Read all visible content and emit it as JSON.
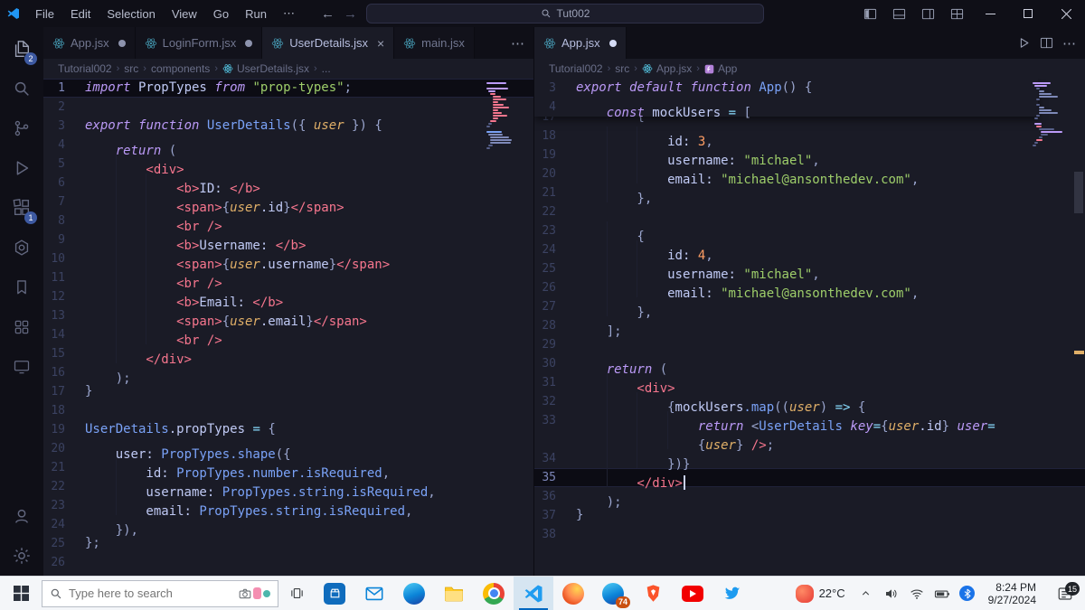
{
  "titlebar": {
    "menus": [
      "File",
      "Edit",
      "Selection",
      "View",
      "Go",
      "Run"
    ],
    "overflow": "⋯",
    "search_label": "Tut002"
  },
  "activity_bar": {
    "explorer_badge": "2",
    "extensions_badge": "1"
  },
  "left_group": {
    "tabs": [
      {
        "label": "App.jsx"
      },
      {
        "label": "LoginForm.jsx"
      },
      {
        "label": "UserDetails.jsx"
      },
      {
        "label": "main.jsx"
      }
    ],
    "overflow": "⋯",
    "breadcrumbs": [
      "Tutorial002",
      "src",
      "components",
      "UserDetails.jsx",
      "..."
    ],
    "lines": [
      {
        "n": 1,
        "hl": true,
        "tok": [
          [
            "kw",
            "import"
          ],
          [
            "v",
            " PropTypes "
          ],
          [
            "kw",
            "from"
          ],
          [
            "str",
            " \"prop-types\""
          ],
          [
            "punc",
            ";"
          ]
        ]
      },
      {
        "n": 2
      },
      {
        "n": 3,
        "tok": [
          [
            "kw",
            "export"
          ],
          [
            "v",
            " "
          ],
          [
            "kw",
            "function"
          ],
          [
            "fn",
            " UserDetails"
          ],
          [
            "punc",
            "({ "
          ],
          [
            "param",
            "user"
          ],
          [
            "punc",
            " }) {"
          ]
        ]
      },
      {
        "n": 4,
        "ind": 1,
        "tok": [
          [
            "kw",
            "return"
          ],
          [
            "punc",
            " ("
          ]
        ]
      },
      {
        "n": 5,
        "ind": 2,
        "tok": [
          [
            "tag",
            "<div>"
          ]
        ]
      },
      {
        "n": 6,
        "ind": 3,
        "tok": [
          [
            "tag",
            "<b>"
          ],
          [
            "v",
            "ID: "
          ],
          [
            "tag",
            "</b>"
          ]
        ]
      },
      {
        "n": 7,
        "ind": 3,
        "tok": [
          [
            "tag",
            "<span>"
          ],
          [
            "punc",
            "{"
          ],
          [
            "param",
            "user"
          ],
          [
            "v",
            ".id"
          ],
          [
            "punc",
            "}"
          ],
          [
            "tag",
            "</span>"
          ]
        ]
      },
      {
        "n": 8,
        "ind": 3,
        "tok": [
          [
            "tag",
            "<br />"
          ]
        ]
      },
      {
        "n": 9,
        "ind": 3,
        "tok": [
          [
            "tag",
            "<b>"
          ],
          [
            "v",
            "Username: "
          ],
          [
            "tag",
            "</b>"
          ]
        ]
      },
      {
        "n": 10,
        "ind": 3,
        "tok": [
          [
            "tag",
            "<span>"
          ],
          [
            "punc",
            "{"
          ],
          [
            "param",
            "user"
          ],
          [
            "v",
            ".username"
          ],
          [
            "punc",
            "}"
          ],
          [
            "tag",
            "</span>"
          ]
        ]
      },
      {
        "n": 11,
        "ind": 3,
        "tok": [
          [
            "tag",
            "<br />"
          ]
        ]
      },
      {
        "n": 12,
        "ind": 3,
        "tok": [
          [
            "tag",
            "<b>"
          ],
          [
            "v",
            "Email: "
          ],
          [
            "tag",
            "</b>"
          ]
        ]
      },
      {
        "n": 13,
        "ind": 3,
        "tok": [
          [
            "tag",
            "<span>"
          ],
          [
            "punc",
            "{"
          ],
          [
            "param",
            "user"
          ],
          [
            "v",
            ".email"
          ],
          [
            "punc",
            "}"
          ],
          [
            "tag",
            "</span>"
          ]
        ]
      },
      {
        "n": 14,
        "ind": 3,
        "tok": [
          [
            "tag",
            "<br />"
          ]
        ]
      },
      {
        "n": 15,
        "ind": 2,
        "tok": [
          [
            "tag",
            "</div>"
          ]
        ]
      },
      {
        "n": 16,
        "ind": 1,
        "tok": [
          [
            "punc",
            ");"
          ]
        ]
      },
      {
        "n": 17,
        "tok": [
          [
            "punc",
            "}"
          ]
        ]
      },
      {
        "n": 18
      },
      {
        "n": 19,
        "tok": [
          [
            "fn",
            "UserDetails"
          ],
          [
            "v",
            ".propTypes"
          ],
          [
            "op",
            " = "
          ],
          [
            "punc",
            "{"
          ]
        ]
      },
      {
        "n": 20,
        "ind": 1,
        "tok": [
          [
            "v",
            "user: "
          ],
          [
            "fn",
            "PropTypes.shape"
          ],
          [
            "punc",
            "({"
          ]
        ]
      },
      {
        "n": 21,
        "ind": 2,
        "tok": [
          [
            "v",
            "id: "
          ],
          [
            "fn",
            "PropTypes.number.isRequired"
          ],
          [
            "punc",
            ","
          ]
        ]
      },
      {
        "n": 22,
        "ind": 2,
        "tok": [
          [
            "v",
            "username: "
          ],
          [
            "fn",
            "PropTypes.string.isRequired"
          ],
          [
            "punc",
            ","
          ]
        ]
      },
      {
        "n": 23,
        "ind": 2,
        "tok": [
          [
            "v",
            "email: "
          ],
          [
            "fn",
            "PropTypes.string.isRequired"
          ],
          [
            "punc",
            ","
          ]
        ]
      },
      {
        "n": 24,
        "ind": 1,
        "tok": [
          [
            "punc",
            "}),"
          ]
        ]
      },
      {
        "n": 25,
        "tok": [
          [
            "punc",
            "};"
          ]
        ]
      },
      {
        "n": 26
      }
    ]
  },
  "right_group": {
    "tabs": [
      {
        "label": "App.jsx"
      }
    ],
    "breadcrumbs": [
      "Tutorial002",
      "src",
      "App.jsx",
      "App"
    ],
    "sticky_lines": [
      {
        "n": 3,
        "tok": [
          [
            "kw",
            "export"
          ],
          [
            "v",
            " "
          ],
          [
            "kw",
            "default"
          ],
          [
            "v",
            " "
          ],
          [
            "kw",
            "function"
          ],
          [
            "fn",
            " App"
          ],
          [
            "punc",
            "() {"
          ]
        ]
      },
      {
        "n": 4,
        "ind": 1,
        "tok": [
          [
            "kw",
            "const"
          ],
          [
            "v",
            " mockUsers "
          ],
          [
            "op",
            "="
          ],
          [
            "punc",
            " ["
          ]
        ]
      }
    ],
    "lines": [
      {
        "n": 17,
        "ind": 2,
        "clip": true,
        "tok": [
          [
            "punc",
            "{"
          ]
        ]
      },
      {
        "n": 18,
        "ind": 3,
        "tok": [
          [
            "v",
            "id: "
          ],
          [
            "num",
            "3"
          ],
          [
            "punc",
            ","
          ]
        ]
      },
      {
        "n": 19,
        "ind": 3,
        "tok": [
          [
            "v",
            "username: "
          ],
          [
            "str",
            "\"michael\""
          ],
          [
            "punc",
            ","
          ]
        ]
      },
      {
        "n": 20,
        "ind": 3,
        "tok": [
          [
            "v",
            "email: "
          ],
          [
            "str",
            "\"michael@ansonthedev.com\""
          ],
          [
            "punc",
            ","
          ]
        ]
      },
      {
        "n": 21,
        "ind": 2,
        "tok": [
          [
            "punc",
            "},"
          ]
        ]
      },
      {
        "n": 22
      },
      {
        "n": 23,
        "ind": 2,
        "tok": [
          [
            "punc",
            "{"
          ]
        ]
      },
      {
        "n": 24,
        "ind": 3,
        "tok": [
          [
            "v",
            "id: "
          ],
          [
            "num",
            "4"
          ],
          [
            "punc",
            ","
          ]
        ]
      },
      {
        "n": 25,
        "ind": 3,
        "tok": [
          [
            "v",
            "username: "
          ],
          [
            "str",
            "\"michael\""
          ],
          [
            "punc",
            ","
          ]
        ]
      },
      {
        "n": 26,
        "ind": 3,
        "tok": [
          [
            "v",
            "email: "
          ],
          [
            "str",
            "\"michael@ansonthedev.com\""
          ],
          [
            "punc",
            ","
          ]
        ]
      },
      {
        "n": 27,
        "ind": 2,
        "tok": [
          [
            "punc",
            "},"
          ]
        ]
      },
      {
        "n": 28,
        "ind": 1,
        "tok": [
          [
            "punc",
            "];"
          ]
        ]
      },
      {
        "n": 29
      },
      {
        "n": 30,
        "ind": 1,
        "tok": [
          [
            "kw",
            "return"
          ],
          [
            "punc",
            " ("
          ]
        ]
      },
      {
        "n": 31,
        "ind": 2,
        "tok": [
          [
            "tag",
            "<div>"
          ]
        ]
      },
      {
        "n": 32,
        "ind": 3,
        "tok": [
          [
            "punc",
            "{"
          ],
          [
            "v",
            "mockUsers"
          ],
          [
            "fn",
            ".map"
          ],
          [
            "punc",
            "(("
          ],
          [
            "param",
            "user"
          ],
          [
            "punc",
            ") "
          ],
          [
            "op",
            "=>"
          ],
          [
            "punc",
            " {"
          ]
        ]
      },
      {
        "n": 33,
        "ind": 4,
        "tok": [
          [
            "kw",
            "return"
          ],
          [
            "v",
            " "
          ],
          [
            "punc",
            "<"
          ],
          [
            "cmp",
            "UserDetails"
          ],
          [
            "attr",
            " key"
          ],
          [
            "op",
            "="
          ],
          [
            "punc",
            "{"
          ],
          [
            "param",
            "user"
          ],
          [
            "v",
            ".id"
          ],
          [
            "punc",
            "}"
          ],
          [
            "attr",
            " user"
          ],
          [
            "op",
            "="
          ]
        ]
      },
      {
        "ind": 4,
        "tok": [
          [
            "punc",
            "{"
          ],
          [
            "param",
            "user"
          ],
          [
            "punc",
            "} "
          ],
          [
            "tag",
            "/>"
          ],
          [
            "punc",
            ";"
          ]
        ]
      },
      {
        "n": 34,
        "ind": 3,
        "tok": [
          [
            "punc",
            "})}"
          ]
        ]
      },
      {
        "n": 35,
        "ind": 2,
        "hl": true,
        "cursor": true,
        "tok": [
          [
            "tag",
            "</div>"
          ]
        ]
      },
      {
        "n": 36,
        "ind": 1,
        "tok": [
          [
            "punc",
            ");"
          ]
        ]
      },
      {
        "n": 37,
        "tok": [
          [
            "punc",
            "}"
          ]
        ]
      },
      {
        "n": 38
      }
    ]
  },
  "taskbar": {
    "search_placeholder": "Type here to search",
    "weather_temp": "22°C",
    "time": "8:24 PM",
    "date": "9/27/2024",
    "edge_badge": "74",
    "notification_count": "15"
  }
}
